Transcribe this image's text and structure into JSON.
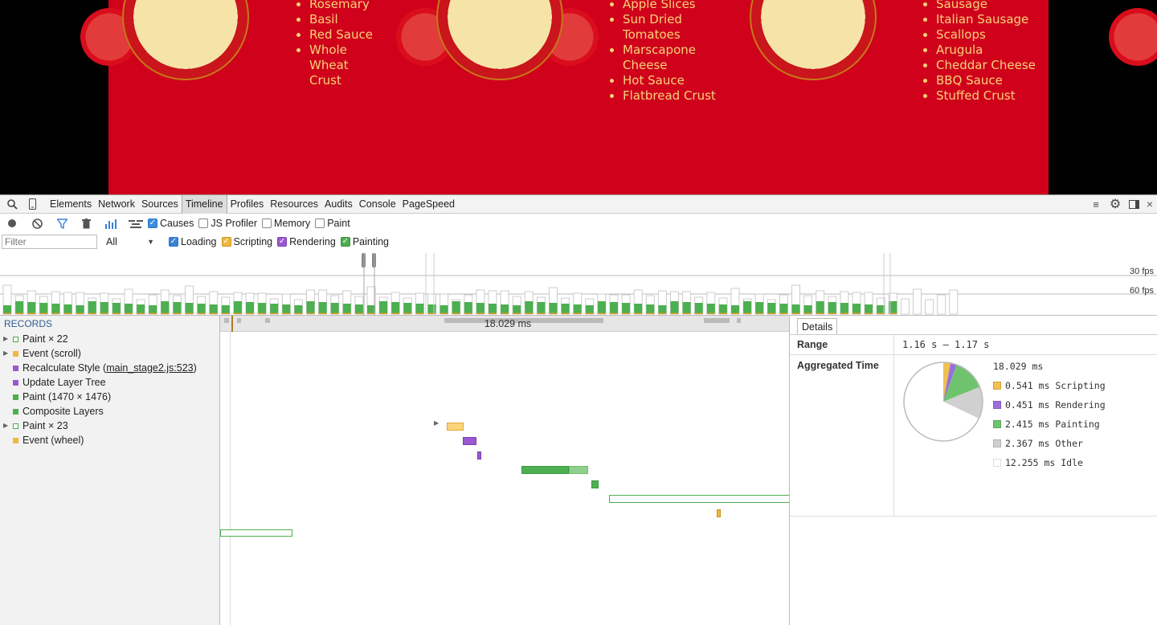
{
  "site": {
    "lists": [
      [
        "Rosemary",
        "Basil",
        "Red Sauce",
        "Whole Wheat Crust"
      ],
      [
        "Apple Slices",
        "Sun Dried Tomatoes",
        "Marscapone Cheese",
        "Hot Sauce",
        "Flatbread Crust"
      ],
      [
        "Sausage",
        "Italian Sausage",
        "Scallops",
        "Arugula",
        "Cheddar Cheese",
        "BBQ Sauce",
        "Stuffed Crust"
      ]
    ]
  },
  "devtools": {
    "tabs": [
      "Elements",
      "Network",
      "Sources",
      "Timeline",
      "Profiles",
      "Resources",
      "Audits",
      "Console",
      "PageSpeed"
    ],
    "active_tab": "Timeline",
    "toolbar": {
      "causes_label": "Causes",
      "js_profiler_label": "JS Profiler",
      "memory_label": "Memory",
      "paint_label": "Paint",
      "filter_placeholder": "Filter",
      "select_value": "All",
      "loading_label": "Loading",
      "scripting_label": "Scripting",
      "rendering_label": "Rendering",
      "painting_label": "Painting"
    },
    "overview": {
      "fps30_label": "30 fps",
      "fps60_label": "60 fps",
      "selection_duration": "18.029 ms"
    },
    "records_header": "RECORDS",
    "records": [
      {
        "label": "Paint × 22",
        "color": "#4caf50",
        "hollow": true,
        "expand": true
      },
      {
        "label": "Event (scroll)",
        "color": "#f0b840",
        "hollow": false,
        "expand": true
      },
      {
        "label": "Recalculate Style (",
        "link": "main_stage2.js:523",
        "suffix": ")",
        "color": "#9b59d0",
        "hollow": false,
        "expand": false
      },
      {
        "label": "Update Layer Tree",
        "color": "#9b59d0",
        "hollow": false,
        "expand": false
      },
      {
        "label": "Paint (1470 × 1476)",
        "color": "#4caf50",
        "hollow": false,
        "expand": false
      },
      {
        "label": "Composite Layers",
        "color": "#4caf50",
        "hollow": false,
        "expand": false
      },
      {
        "label": "Paint × 23",
        "color": "#4caf50",
        "hollow": true,
        "expand": true
      },
      {
        "label": "Event (wheel)",
        "color": "#f0b840",
        "hollow": false,
        "expand": false
      }
    ],
    "details": {
      "tab_label": "Details",
      "range_label": "Range",
      "range_value": "1.16 s – 1.17 s",
      "aggregated_label": "Aggregated Time",
      "total": "18.029 ms",
      "breakdown": [
        {
          "value": "0.541 ms",
          "name": "Scripting",
          "color": "#f0c050",
          "ms": 0.541
        },
        {
          "value": "0.451 ms",
          "name": "Rendering",
          "color": "#9b6ddc",
          "ms": 0.451
        },
        {
          "value": "2.415 ms",
          "name": "Painting",
          "color": "#6fc36f",
          "ms": 2.415
        },
        {
          "value": "2.367 ms",
          "name": "Other",
          "color": "#d0d0d0",
          "ms": 2.367
        },
        {
          "value": "12.255 ms",
          "name": "Idle",
          "color": "#ffffff",
          "ms": 12.255
        }
      ]
    }
  }
}
